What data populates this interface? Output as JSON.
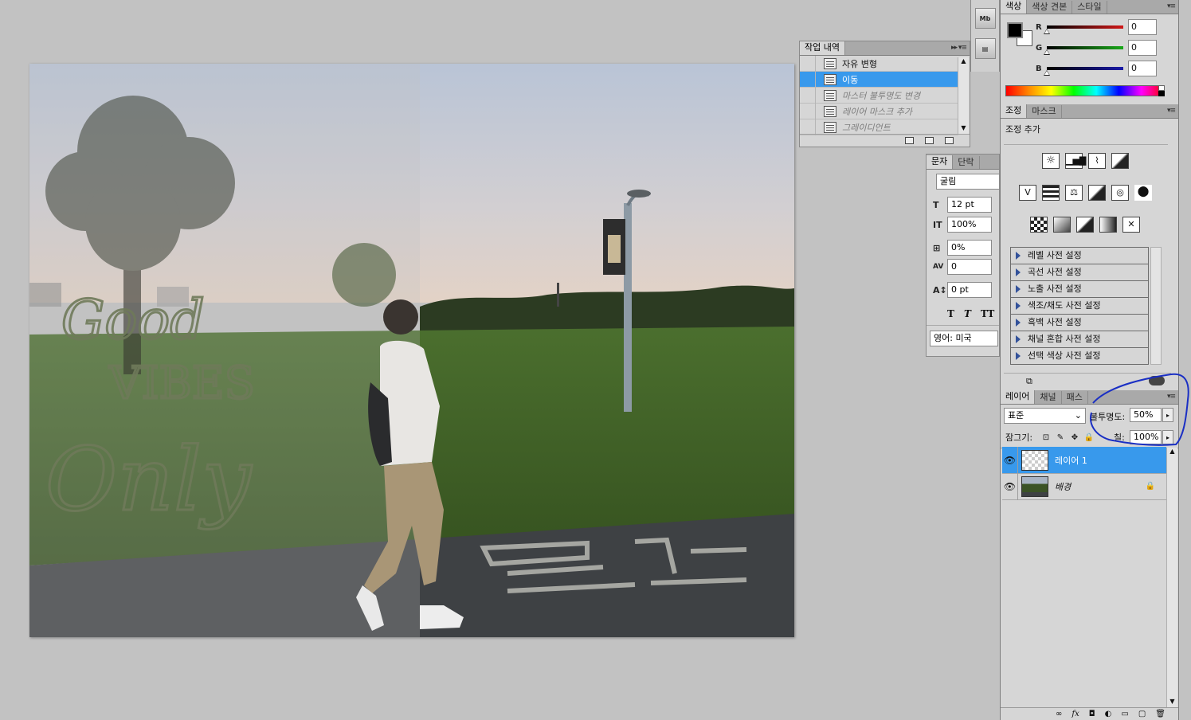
{
  "history": {
    "tab": "작업 내역",
    "items": [
      {
        "label": "자유 변형",
        "state": "normal"
      },
      {
        "label": "이동",
        "state": "selected"
      },
      {
        "label": "마스터 불투명도 변경",
        "state": "dim"
      },
      {
        "label": "레이어 마스크 추가",
        "state": "dim"
      },
      {
        "label": "그레이디언트",
        "state": "dim"
      }
    ]
  },
  "character": {
    "tabs": [
      "문자",
      "단락"
    ],
    "font": "굴림",
    "size": "12 pt",
    "scale": "100%",
    "scale_pct": "0%",
    "tracking": "0",
    "baseline": "0 pt",
    "styles": [
      "T",
      "T",
      "TT"
    ],
    "language": "영어: 미국"
  },
  "color": {
    "tabs": [
      "색상",
      "색상 견본",
      "스타일"
    ],
    "channels": [
      {
        "label": "R",
        "value": "0",
        "color": "#d01818"
      },
      {
        "label": "G",
        "value": "0",
        "color": "#1aa81a"
      },
      {
        "label": "B",
        "value": "0",
        "color": "#1a1aa8"
      }
    ],
    "foreground": "#000000",
    "background": "#ffffff"
  },
  "adjustments": {
    "tabs": [
      "조정",
      "마스크"
    ],
    "heading": "조정 추가",
    "presets": [
      "레벨 사전 설정",
      "곡선 사전 설정",
      "노출 사전 설정",
      "색조/채도 사전 설정",
      "흑백 사전 설정",
      "채널 혼합 사전 설정",
      "선택 색상 사전 설정"
    ]
  },
  "layers": {
    "tabs": [
      "레이어",
      "채널",
      "패스"
    ],
    "blend_mode": "표준",
    "opacity_label": "불투명도:",
    "opacity": "50%",
    "lock_label": "잠그기:",
    "fill_label": "칠:",
    "fill": "100%",
    "items": [
      {
        "name": "레이어 1",
        "selected": true
      },
      {
        "name": "배경",
        "selected": false
      }
    ]
  },
  "canvas": {
    "overlay_text": [
      "Good",
      "VIBES",
      "Only"
    ]
  },
  "annotation_color": "#1a2fc4",
  "accent": "#3899ec"
}
